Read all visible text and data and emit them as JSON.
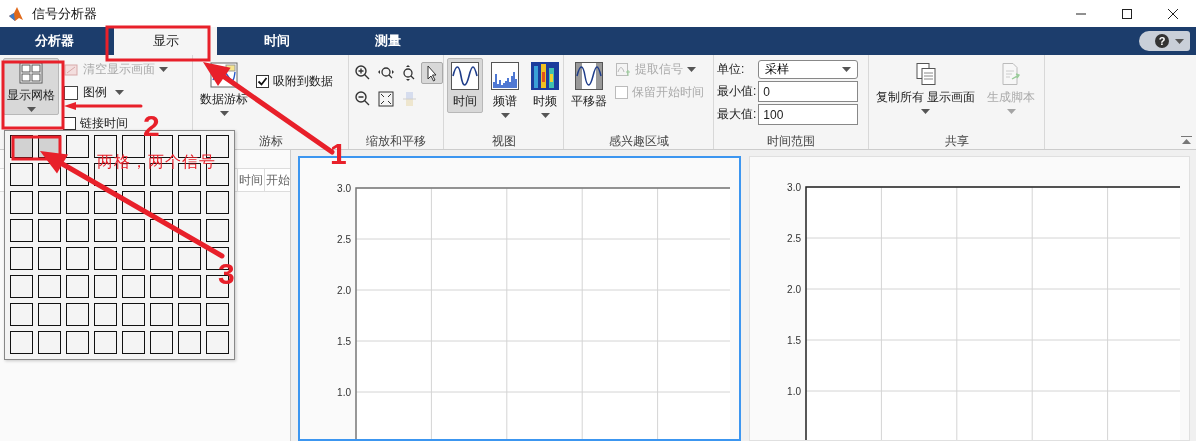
{
  "window": {
    "title": "信号分析器"
  },
  "tabs": [
    {
      "label": "分析器",
      "selected": false
    },
    {
      "label": "显示",
      "selected": true
    },
    {
      "label": "时间",
      "selected": false
    },
    {
      "label": "测量",
      "selected": false
    }
  ],
  "help": {
    "label": "?"
  },
  "ribbon": {
    "display": {
      "grid_button": {
        "label": "显示网格",
        "pressed": true
      },
      "clear": {
        "label": "清空显示画面",
        "disabled": true
      },
      "legend": {
        "label": "图例"
      },
      "link_time": {
        "label": "链接时间",
        "checked": false
      }
    },
    "cursors": {
      "section": "游标",
      "data_cursor": {
        "label": "数据游标"
      },
      "snap": {
        "label": "吸附到数据",
        "checked": true
      }
    },
    "zoom": {
      "section": "缩放和平移",
      "tools": [
        {
          "kind": "zoom-in",
          "selected": false,
          "disabled": false
        },
        {
          "kind": "zoom-x",
          "selected": false,
          "disabled": false
        },
        {
          "kind": "zoom-y",
          "selected": false,
          "disabled": false
        },
        {
          "kind": "select",
          "selected": true,
          "disabled": false
        },
        {
          "kind": "zoom-out",
          "selected": false,
          "disabled": false
        },
        {
          "kind": "fit",
          "selected": false,
          "disabled": false
        },
        {
          "kind": "colorbar",
          "selected": false,
          "disabled": true
        }
      ]
    },
    "views": {
      "section": "视图",
      "items": [
        {
          "label": "时间",
          "kind": "time",
          "selected": true,
          "dropdown": false
        },
        {
          "label": "频谱",
          "kind": "spectrum",
          "selected": false,
          "dropdown": true
        },
        {
          "label": "时频",
          "kind": "spectrogram",
          "selected": false,
          "dropdown": true
        }
      ]
    },
    "roi": {
      "section": "感兴趣区域",
      "panner": {
        "label": "平移器"
      },
      "extract": {
        "label": "提取信号",
        "disabled": true
      },
      "keep_start": {
        "label": "保留开始时间",
        "checked": false,
        "disabled": true
      }
    },
    "time_range": {
      "section": "时间范围",
      "units": {
        "label": "单位:",
        "value": "采样"
      },
      "min": {
        "label": "最小值:",
        "value": "0"
      },
      "max": {
        "label": "最大值:",
        "value": "100"
      }
    },
    "share": {
      "section": "共享",
      "copy": {
        "label": "复制所有 显示画面"
      },
      "script": {
        "label": "生成脚本",
        "disabled": true
      }
    }
  },
  "side_panel": {
    "columns": [
      "时间",
      "开始"
    ]
  },
  "grid_popup": {
    "rows": [
      {
        "cells": [
          {
            "selected": true
          },
          {
            "selected": true
          },
          {
            "selected": false
          },
          {
            "selected": false
          },
          {
            "selected": false
          },
          {
            "selected": false
          },
          {
            "selected": false
          },
          {
            "selected": false
          }
        ]
      },
      {
        "cells": [
          {
            "selected": false
          },
          {
            "selected": false
          },
          {
            "selected": false
          },
          {
            "selected": false
          },
          {
            "selected": false
          },
          {
            "selected": false
          },
          {
            "selected": false
          },
          {
            "selected": false
          }
        ]
      },
      {
        "cells": [
          {
            "selected": false
          },
          {
            "selected": false
          },
          {
            "selected": false
          },
          {
            "selected": false
          },
          {
            "selected": false
          },
          {
            "selected": false
          },
          {
            "selected": false
          },
          {
            "selected": false
          }
        ]
      },
      {
        "cells": [
          {
            "selected": false
          },
          {
            "selected": false
          },
          {
            "selected": false
          },
          {
            "selected": false
          },
          {
            "selected": false
          },
          {
            "selected": false
          },
          {
            "selected": false
          },
          {
            "selected": false
          }
        ]
      },
      {
        "cells": [
          {
            "selected": false
          },
          {
            "selected": false
          },
          {
            "selected": false
          },
          {
            "selected": false
          },
          {
            "selected": false
          },
          {
            "selected": false
          },
          {
            "selected": false
          },
          {
            "selected": false
          }
        ]
      },
      {
        "cells": [
          {
            "selected": false
          },
          {
            "selected": false
          },
          {
            "selected": false
          },
          {
            "selected": false
          },
          {
            "selected": false
          },
          {
            "selected": false
          },
          {
            "selected": false
          },
          {
            "selected": false
          }
        ]
      },
      {
        "cells": [
          {
            "selected": false
          },
          {
            "selected": false
          },
          {
            "selected": false
          },
          {
            "selected": false
          },
          {
            "selected": false
          },
          {
            "selected": false
          },
          {
            "selected": false
          },
          {
            "selected": false
          }
        ]
      },
      {
        "cells": [
          {
            "selected": false
          },
          {
            "selected": false
          },
          {
            "selected": false
          },
          {
            "selected": false
          },
          {
            "selected": false
          },
          {
            "selected": false
          },
          {
            "selected": false
          },
          {
            "selected": false
          }
        ]
      }
    ]
  },
  "plots": [
    {
      "selected": true,
      "y_tick_labels": [
        "3.0",
        "2.5",
        "2.0",
        "1.5",
        "1.0"
      ]
    },
    {
      "selected": false,
      "y_tick_labels": [
        "3.0",
        "2.5",
        "2.0",
        "1.5",
        "1.0"
      ]
    }
  ],
  "annotations": {
    "marks": [
      {
        "label": "1"
      },
      {
        "label": "2"
      },
      {
        "label": "3"
      }
    ],
    "note": "两格，两个信号"
  }
}
